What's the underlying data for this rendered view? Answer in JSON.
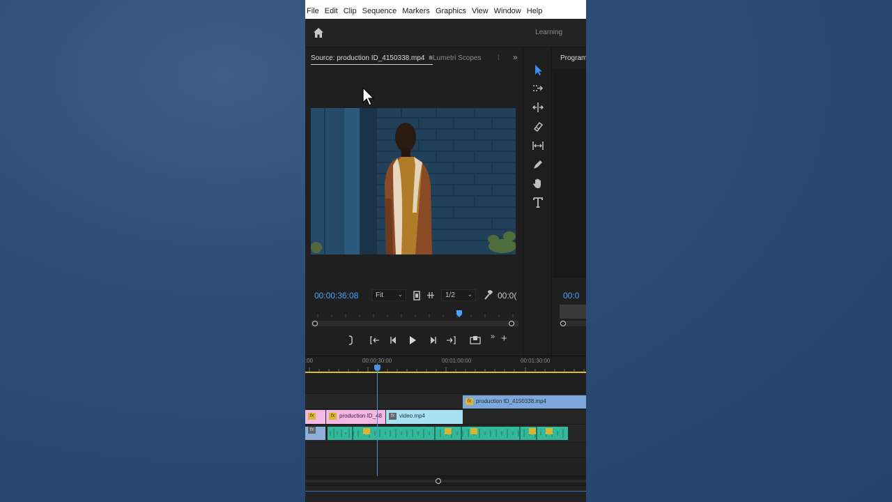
{
  "menu": [
    "File",
    "Edit",
    "Clip",
    "Sequence",
    "Markers",
    "Graphics",
    "View",
    "Window",
    "Help"
  ],
  "header": {
    "workspace": "Learning"
  },
  "source": {
    "tab_label": "Source: production ID_4150338.mp4",
    "tab_menu": "≡",
    "lumetri_tab": "Lumetri Scopes",
    "more_tabs": "⁞",
    "overflow": "»",
    "timecode": "00:00:36:08",
    "zoom": "Fit",
    "resolution": "1/2",
    "timecode_right": "00:0("
  },
  "program": {
    "label": "Program:",
    "timecode": "00:0"
  },
  "timeline": {
    "ruler_labels": [
      ":00",
      "00:00:30:00",
      "00:01:00:00",
      "00:01:30:00"
    ],
    "clips": {
      "v2": "production ID_4150338.mp4",
      "v1_a": "production ID_48",
      "v1_b": "video.mp4"
    },
    "fx_label": "fx"
  },
  "colors": {
    "accent_blue": "#4aa2ff",
    "clip_pink": "#f4b8e4",
    "clip_cyan": "#a8e1f3",
    "clip_blue": "#7ea8dc",
    "audio_green": "#33b89a",
    "inout_yellow": "#d8c32f"
  }
}
